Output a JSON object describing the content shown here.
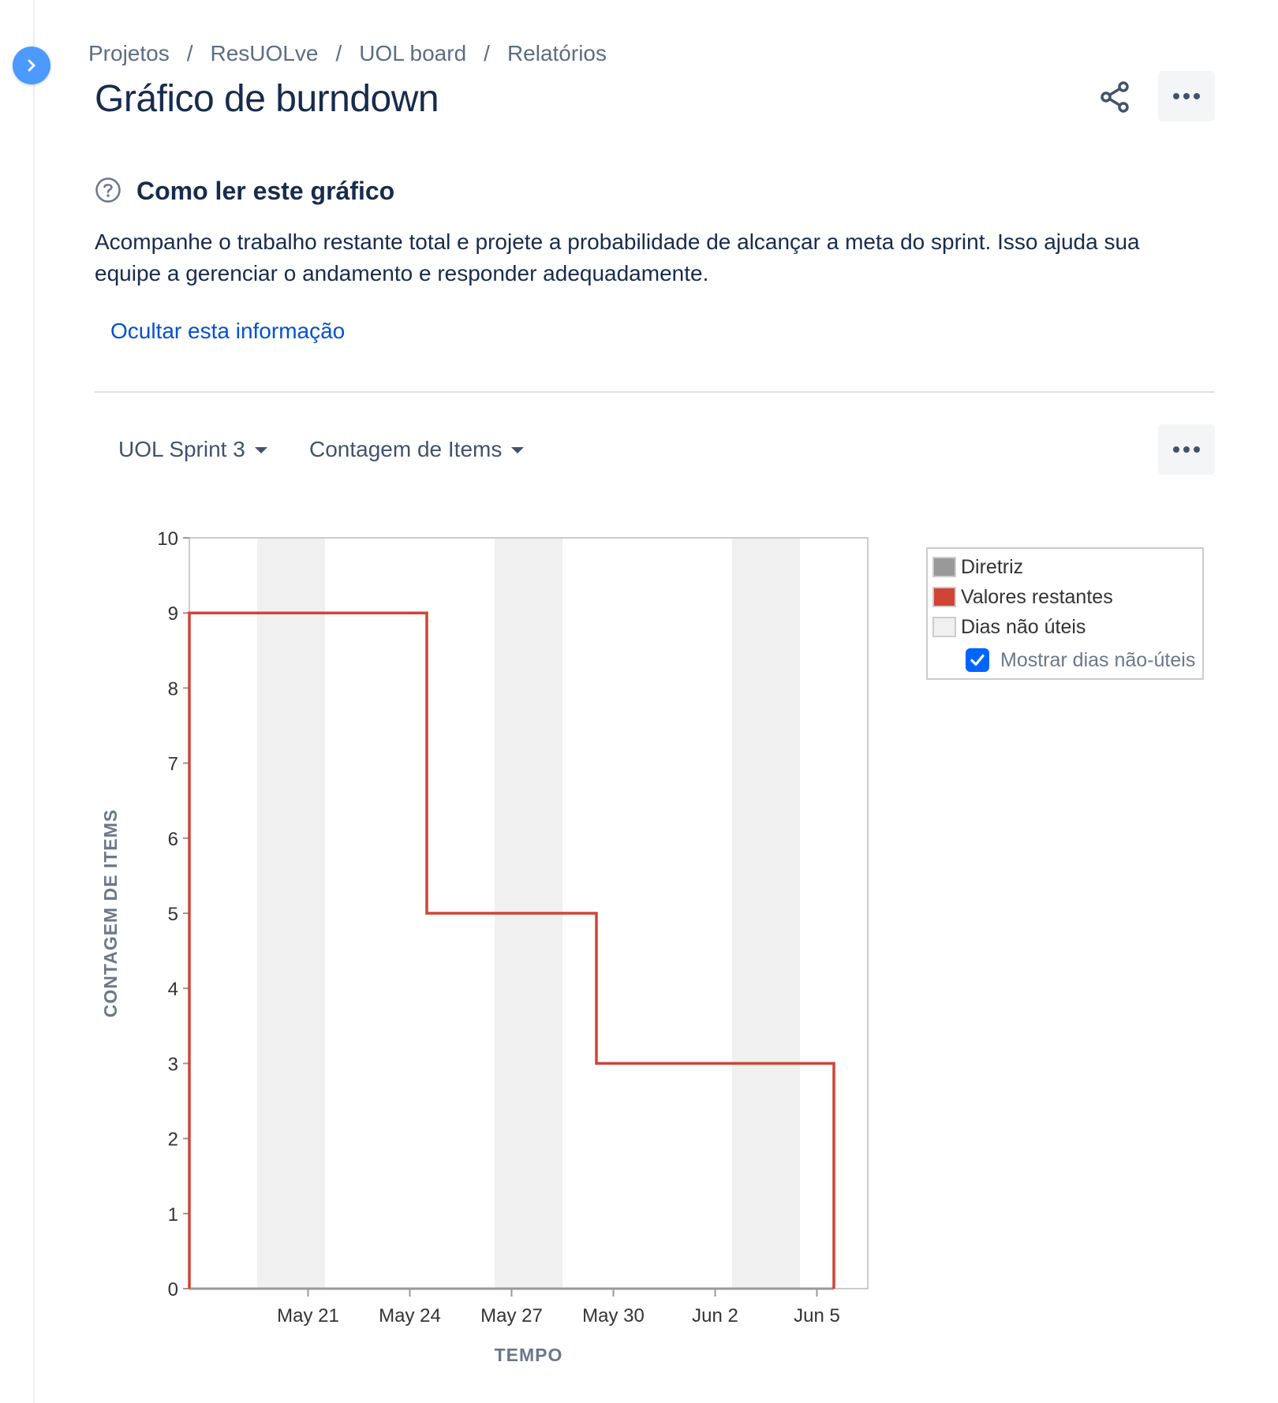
{
  "breadcrumb": [
    "Projetos",
    "ResUOLve",
    "UOL board",
    "Relatórios"
  ],
  "page": {
    "title": "Gráfico de burndown"
  },
  "help": {
    "title": "Como ler este gráfico",
    "description": "Acompanhe o trabalho restante total e projete a probabilidade de alcançar a meta do sprint. Isso ajuda sua equipe a gerenciar o andamento e responder adequadamente.",
    "hide_link": "Ocultar esta informação"
  },
  "filters": {
    "sprint": "UOL Sprint 3",
    "metric": "Contagem de Items"
  },
  "icons": {
    "expand": "chevron-right-icon",
    "share": "share-icon",
    "more": "more-horizontal-icon",
    "help": "question-circle-icon",
    "check": "checkmark-icon"
  },
  "colors": {
    "guideline": "#999999",
    "remaining": "#d04437",
    "non_working": "#f0f0f0",
    "link": "#0052cc",
    "accent": "#4c9aff"
  },
  "legend": {
    "items": [
      {
        "label": "Diretriz",
        "color": "#999999"
      },
      {
        "label": "Valores restantes",
        "color": "#d04437"
      },
      {
        "label": "Dias não úteis",
        "color": "#f0f0f0"
      }
    ],
    "checkbox_label": "Mostrar dias não-úteis",
    "checkbox_checked": true
  },
  "chart_data": {
    "type": "line",
    "title": "",
    "xlabel": "TEMPO",
    "ylabel": "CONTAGEM DE ITEMS",
    "ylim": [
      0,
      10
    ],
    "yticks": [
      0,
      1,
      2,
      3,
      4,
      5,
      6,
      7,
      8,
      9,
      10
    ],
    "xlim": [
      "2021-05-18",
      "2021-06-06"
    ],
    "xticks": [
      {
        "date": "2021-05-21",
        "label": "May 21"
      },
      {
        "date": "2021-05-24",
        "label": "May 24"
      },
      {
        "date": "2021-05-27",
        "label": "May 27"
      },
      {
        "date": "2021-05-30",
        "label": "May 30"
      },
      {
        "date": "2021-06-02",
        "label": "Jun 2"
      },
      {
        "date": "2021-06-05",
        "label": "Jun 5"
      }
    ],
    "non_working_days": [
      [
        "2021-05-20",
        "2021-05-22"
      ],
      [
        "2021-05-27",
        "2021-05-29"
      ],
      [
        "2021-06-03",
        "2021-06-05"
      ]
    ],
    "series": [
      {
        "name": "Valores restantes",
        "type": "step",
        "points": [
          [
            "2021-05-18",
            0
          ],
          [
            "2021-05-18",
            9
          ],
          [
            "2021-05-25",
            9
          ],
          [
            "2021-05-25",
            5
          ],
          [
            "2021-05-30",
            5
          ],
          [
            "2021-05-30",
            3
          ],
          [
            "2021-06-06",
            3
          ],
          [
            "2021-06-06",
            0
          ]
        ]
      },
      {
        "name": "Diretriz",
        "points": [
          [
            "2021-05-18",
            0
          ],
          [
            "2021-06-06",
            0
          ]
        ]
      }
    ],
    "grid": false,
    "legend_position": "right"
  }
}
